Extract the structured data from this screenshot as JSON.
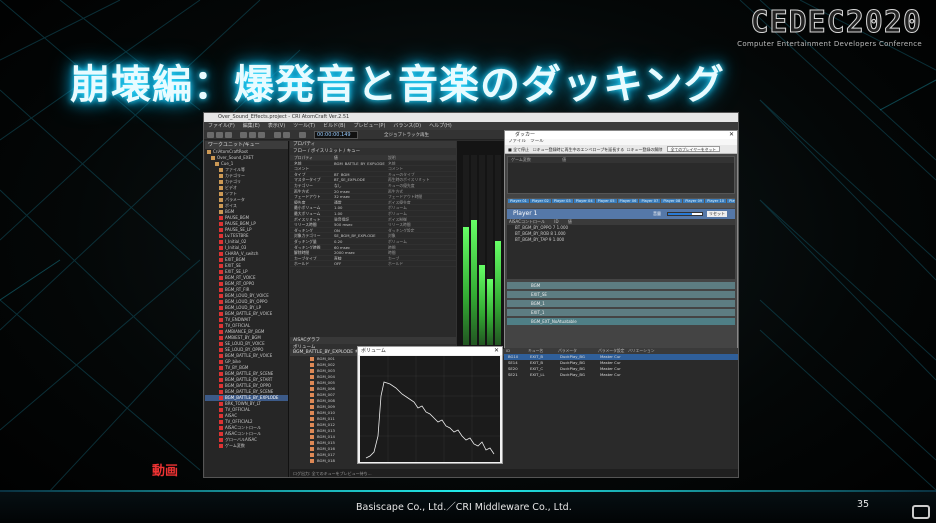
{
  "slide": {
    "title": "崩壊編：爆発音と音楽のダッキング",
    "video_label": "動画",
    "credit": "Basiscape Co., Ltd.／CRI Middleware Co., Ltd.",
    "page_number": "35",
    "logo": {
      "text": "CEDEC2020",
      "subtitle": "Computer Entertainment Developers Conference"
    }
  },
  "app": {
    "window_title": "Over_Sound_Effects.project - CRI AtomCraft Ver.2.51",
    "menu": [
      "ファイル(F)",
      "編集(E)",
      "表示(V)",
      "ツール(T)",
      "ビルド(B)",
      "プレビュー(P)",
      "バランス(D)",
      "ヘルプ(H)"
    ],
    "time_field": "00:00:00.149",
    "master_check": "全ジョブトラック再生",
    "tree": {
      "header": "ワークユニット/キュー",
      "items": [
        "CriAtomCraftRoot",
        "Over_Sound_EXET",
        "Cue_1",
        "ファイル等",
        "カテゴリー",
        "カテゴリ",
        "ビデオ",
        "ソフト",
        "パラメータ",
        "ボイス",
        "BGM",
        "PAUSE_BGM",
        "PAUSE_BGM_LP",
        "PAUSE_SE_LP",
        "Lv.TESTBRE",
        "I_Initial_02",
        "I_Initial_03",
        "CHARA_V_switch",
        "EXIT_BGM",
        "EXIT_SE",
        "EXIT_SE_LP",
        "BGM_RT_VOICE",
        "BGM_RT_OPPO",
        "BGM_RT_FIR",
        "BGM_LOUD_BY_VOICE",
        "BGM_LOUD_BY_OPPO",
        "BGM_LOUD_BY_LP",
        "BGM_BATTLE_BY_VOICE",
        "TV_ENDWAIT",
        "TV_OFFICIAL",
        "AMBIANCE_BY_BGM",
        "AMBIEST_BY_BGM",
        "SE_LOUD_BY_VOICE",
        "SE_LOUD_BY_OPPO",
        "BGM_BATTLE_BY_VOICE",
        "GP_bike",
        "TV_BY_BGM",
        "BGM_BATTLE_BY_SCENE",
        "BGM_BATTLE_BY_START",
        "BGM_BATTLE_BY_OPPO",
        "BGM_BATTLE_BY_SCENE",
        "BGM_BATTLE_BY_EXPLODE",
        "BRK_TOWN_BY_LT",
        "TV_OFFICIAL",
        "AISAC",
        "TV_OFFICIAL2",
        "AISACコントロール",
        "AISACコントロール",
        "グローバルAISAC",
        "ゲーム変数"
      ],
      "selected_index": 41
    },
    "inspector": {
      "title": "プロパティ",
      "tabs": "フロー / ボイスリミット / キュー",
      "columns": [
        "プロパティ",
        "値",
        "説明"
      ],
      "rows": [
        [
          "名前",
          "BGM_BATTLE_BY_EXPLODE",
          "名前"
        ],
        [
          "コメント",
          "",
          "コメント"
        ],
        [
          "タイプ",
          "BT_BGM",
          "キューのタイプ"
        ],
        [
          "マスタータイプ",
          "BT_SE_EXPLODE",
          "再生時のボイスリミット"
        ],
        [
          "カテゴリー",
          "なし",
          "キューの優先度"
        ],
        [
          "再生方式",
          "20 msec",
          "再生方式"
        ],
        [
          "フェードアウト",
          "32 msec",
          "フェードアウト時間"
        ],
        [
          "優先度",
          "通常",
          "ボイス優先度"
        ],
        [
          "最小ボリューム",
          "1.00",
          "ボリューム"
        ],
        [
          "最大ボリューム",
          "1.00",
          "ボリューム"
        ],
        [
          "ボイスリミット",
          "発音保証",
          "ボイス制御"
        ],
        [
          "リリース時間",
          "500 msec",
          "リリース時間"
        ],
        [
          "ダッキング",
          "ON",
          "ダッキング設定"
        ],
        [
          "対象カテゴリー",
          "SE_BGM_BY_EXPLODE",
          "対象"
        ],
        [
          "ダッキング量",
          "0.20",
          "ボリューム"
        ],
        [
          "ダッキング時間",
          "60 msec",
          "時間"
        ],
        [
          "解除時間",
          "2000 msec",
          "時間"
        ],
        [
          "カーブタイプ",
          "直線",
          "カーブ"
        ],
        [
          "ホールド",
          "OFF",
          "ホールド"
        ]
      ]
    },
    "curve_panel": {
      "title": "AISACグラフ",
      "label": "ボリューム"
    },
    "ducker": {
      "title": "ダッカー",
      "menu": [
        "ファイル",
        "ツール"
      ],
      "toolbar_label": "全て停止",
      "toolbar_checks": [
        "キュー登録時に再生中のエンベロープを延長する",
        "キュー登録の解除"
      ],
      "toolbar_button": "全てのプレイヤーをセット",
      "list_head": [
        "ゲーム変数",
        "値"
      ],
      "player_tabs": [
        "Player 01",
        "Player 02",
        "Player 03",
        "Player 04",
        "Player 05",
        "Player 06",
        "Player 07",
        "Player 08",
        "Player 09",
        "Player 10",
        "Player 11",
        "Player 12",
        "Player 13",
        "Player 14",
        "Player 15",
        "Player 16"
      ],
      "player_name": "Player 1",
      "volume_label": "音量",
      "reset_label": "リセット",
      "control_head": [
        "AISACコントロール",
        "ID",
        "値"
      ],
      "controls": [
        "BT_BGM_BY_OPPO  7   1.000",
        "BT_BGM_BY_ROB  8   1.000",
        "BT_BGM_BY_TAP  9   1.000"
      ],
      "tracks": [
        "BGM",
        "EXIT_SE",
        "BGM_1",
        "EXIT_1",
        "BGM_EXT_NoAtuatable"
      ]
    },
    "graph": {
      "title": "ボリューム"
    },
    "right_grid": {
      "headers": [
        "ID",
        "キュー名",
        "パラメータ",
        "パラメータ設定",
        "バリエーション"
      ],
      "rows": [
        [
          "BG10",
          "EXIT_B",
          "DuckPlay_BG",
          "Master Cur"
        ],
        [
          "SE14",
          "EXIT_B",
          "DuckPlay_BG",
          "Master Cur"
        ],
        [
          "SE20",
          "EXIT_C",
          "DuckPlay_BG",
          "Master Cur"
        ],
        [
          "SE21",
          "EXIT_LL",
          "DuckPlay_BG",
          "Master Cur"
        ]
      ]
    },
    "cue_list": {
      "title": "BGM_BATTLE_BY_EXPLODE キュー一覧",
      "rows": [
        "BGM_001",
        "BGM_002",
        "BGM_003",
        "BGM_004",
        "BGM_005",
        "BGM_006",
        "BGM_007",
        "BGM_008",
        "BGM_009",
        "BGM_010",
        "BGM_011",
        "BGM_012",
        "BGM_013",
        "BGM_014",
        "BGM_015",
        "BGM_016",
        "BGM_017",
        "BGM_018"
      ]
    },
    "status": "ログ出力: 全てのキューをプレビュー待ち…"
  },
  "meter_levels": [
    0.62,
    0.66,
    0.42,
    0.35,
    0.55
  ]
}
